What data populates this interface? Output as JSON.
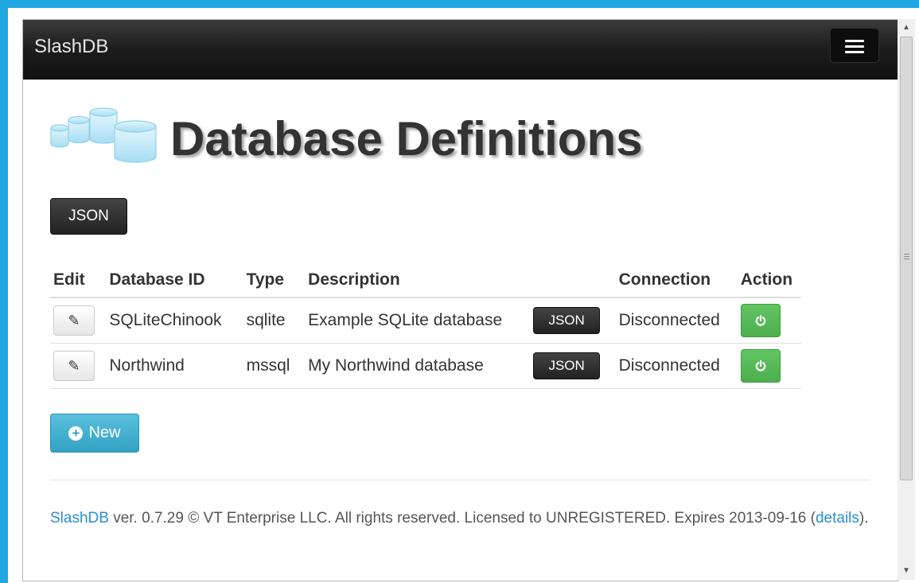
{
  "navbar": {
    "brand": "SlashDB",
    "menu_icon": "hamburger-menu-icon"
  },
  "page": {
    "logo_icon": "database-cylinders-icon",
    "title": "Database Definitions",
    "json_button": "JSON"
  },
  "table": {
    "headers": [
      "Edit",
      "Database ID",
      "Type",
      "Description",
      "",
      "Connection",
      "Action"
    ],
    "rows": [
      {
        "edit_icon": "pencil-icon",
        "id": "SQLiteChinook",
        "type": "sqlite",
        "description": "Example SQLite database",
        "json": "JSON",
        "connection": "Disconnected",
        "action_icon": "power-icon"
      },
      {
        "edit_icon": "pencil-icon",
        "id": "Northwind",
        "type": "mssql",
        "description": "My Northwind database",
        "json": "JSON",
        "connection": "Disconnected",
        "action_icon": "power-icon"
      }
    ]
  },
  "new_button": {
    "label": "New",
    "icon": "plus-circle-icon"
  },
  "footer": {
    "brand_link": "SlashDB",
    "text_1": " ver. 0.7.29 © VT Enterprise LLC. All rights reserved. Licensed to UNREGISTERED. Expires 2013-09-16 (",
    "details_link": "details",
    "text_2": ")."
  },
  "colors": {
    "frame_background": "#1ea7e1",
    "navbar": "#1e1e1e",
    "success": "#5cb85c",
    "info": "#5bc0de",
    "link": "#2a8fd0"
  }
}
